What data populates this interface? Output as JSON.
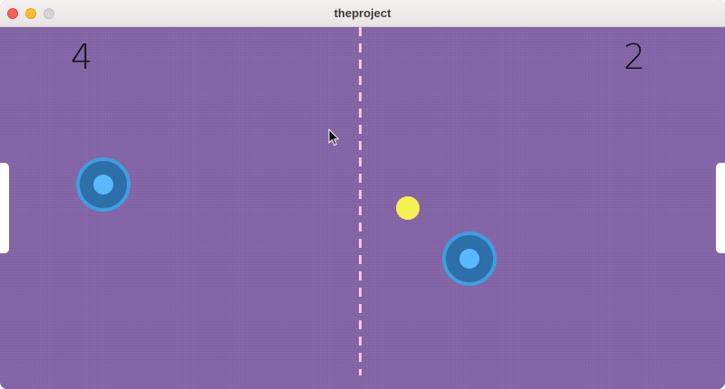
{
  "window": {
    "title": "theproject",
    "controls": [
      "close",
      "minimize",
      "zoom"
    ]
  },
  "game": {
    "scores": {
      "left": "4",
      "right": "2"
    },
    "colors": {
      "field": "#8667a8",
      "center_line": "#f3c8d8",
      "mallet_body": "#2d6fa8",
      "mallet_ring": "#3e9ee0",
      "mallet_knob": "#59b8ff",
      "puck": "#f7f053",
      "goal": "#ffffff"
    },
    "icons": {
      "cursor": "mouse-pointer-icon"
    }
  }
}
